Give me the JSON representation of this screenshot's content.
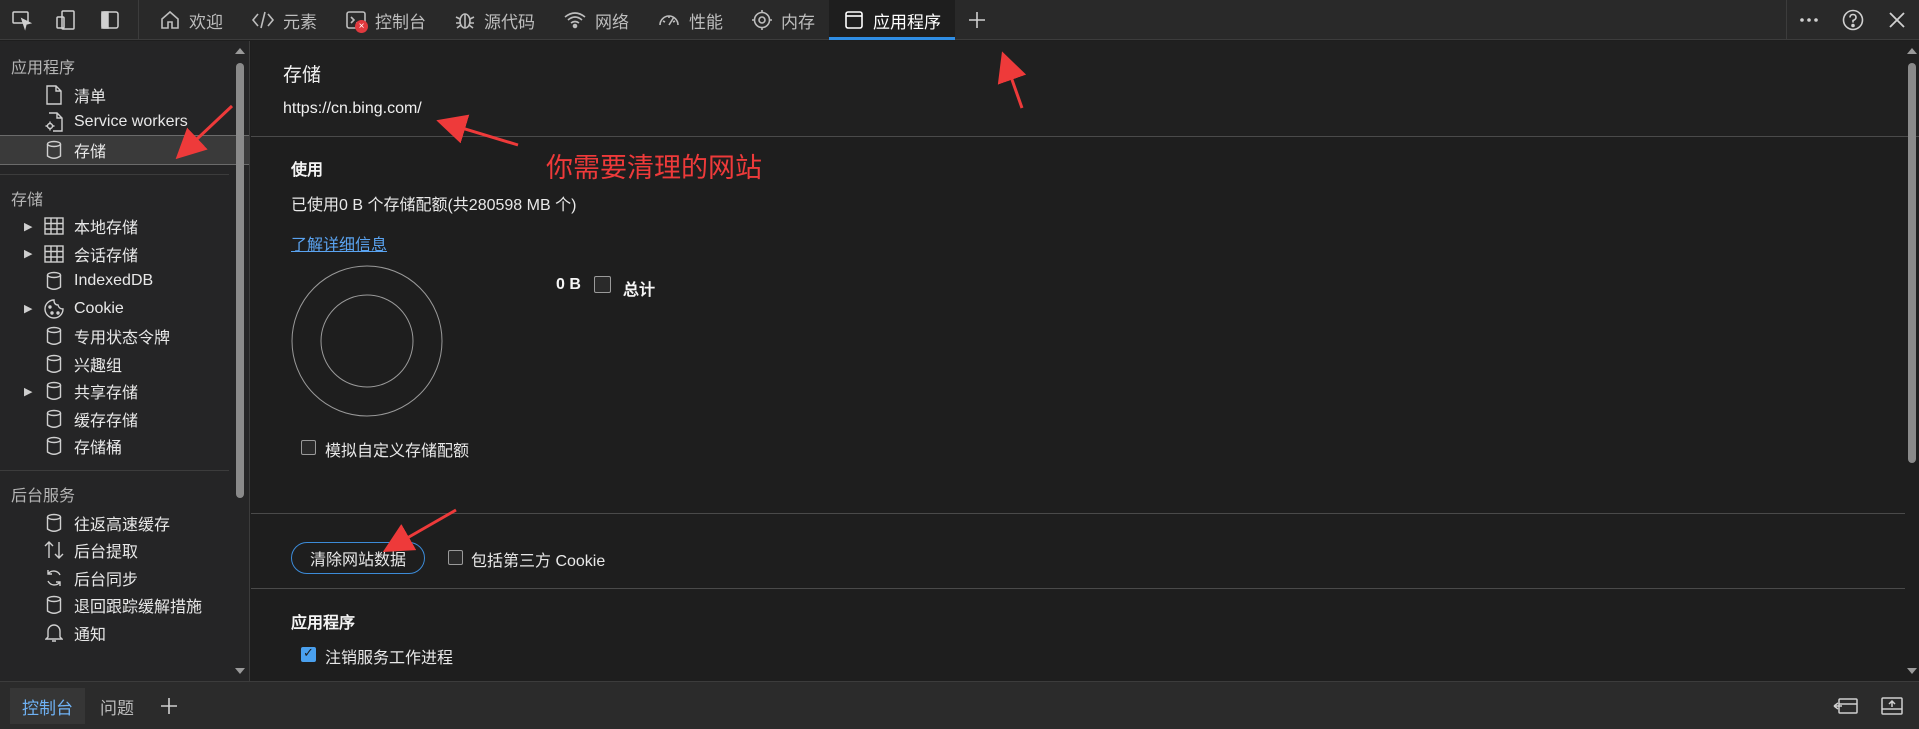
{
  "toolbar": {
    "tabs": [
      {
        "label": "欢迎",
        "icon": "home-icon"
      },
      {
        "label": "元素",
        "icon": "code-icon"
      },
      {
        "label": "控制台",
        "icon": "console-icon",
        "badge": "×"
      },
      {
        "label": "源代码",
        "icon": "bug-icon"
      },
      {
        "label": "网络",
        "icon": "wifi-icon"
      },
      {
        "label": "性能",
        "icon": "gauge-icon"
      },
      {
        "label": "内存",
        "icon": "gear-icon"
      },
      {
        "label": "应用程序",
        "icon": "window-icon"
      }
    ],
    "active_tab": "应用程序"
  },
  "sidebar": {
    "sections": [
      {
        "title": "应用程序",
        "items": [
          {
            "label": "清单",
            "icon": "file-icon"
          },
          {
            "label": "Service workers",
            "icon": "gear-file-icon"
          },
          {
            "label": "存储",
            "icon": "database-icon",
            "selected": true
          }
        ]
      },
      {
        "title": "存储",
        "items": [
          {
            "label": "本地存储",
            "icon": "grid-icon",
            "expandable": true
          },
          {
            "label": "会话存储",
            "icon": "grid-icon",
            "expandable": true
          },
          {
            "label": "IndexedDB",
            "icon": "database-icon"
          },
          {
            "label": "Cookie",
            "icon": "cookie-icon",
            "expandable": true
          },
          {
            "label": "专用状态令牌",
            "icon": "database-icon"
          },
          {
            "label": "兴趣组",
            "icon": "database-icon"
          },
          {
            "label": "共享存储",
            "icon": "database-icon",
            "expandable": true
          },
          {
            "label": "缓存存储",
            "icon": "database-icon"
          },
          {
            "label": "存储桶",
            "icon": "database-icon"
          }
        ]
      },
      {
        "title": "后台服务",
        "items": [
          {
            "label": "往返高速缓存",
            "icon": "database-icon"
          },
          {
            "label": "后台提取",
            "icon": "arrows-updown-icon"
          },
          {
            "label": "后台同步",
            "icon": "sync-icon"
          },
          {
            "label": "退回跟踪缓解措施",
            "icon": "database-icon"
          },
          {
            "label": "通知",
            "icon": "bell-icon"
          }
        ]
      }
    ]
  },
  "main": {
    "title": "存储",
    "url": "https://cn.bing.com/",
    "usage": {
      "title": "使用",
      "text": "已使用0 B 个存储配额(共280598 MB 个)",
      "learn_more": "了解详细信息",
      "total_value": "0 B",
      "total_label": "总计",
      "simulate_label": "模拟自定义存储配额"
    },
    "clear_button": "清除网站数据",
    "third_party_cookie_label": "包括第三方 Cookie",
    "app_section": {
      "title": "应用程序",
      "unregister_label": "注销服务工作进程",
      "unregister_checked": true
    }
  },
  "annotation": {
    "text": "你需要清理的网站",
    "color": "#ee3a3a"
  },
  "bottombar": {
    "tabs": [
      {
        "label": "控制台",
        "active": true
      },
      {
        "label": "问题",
        "active": false
      }
    ]
  }
}
